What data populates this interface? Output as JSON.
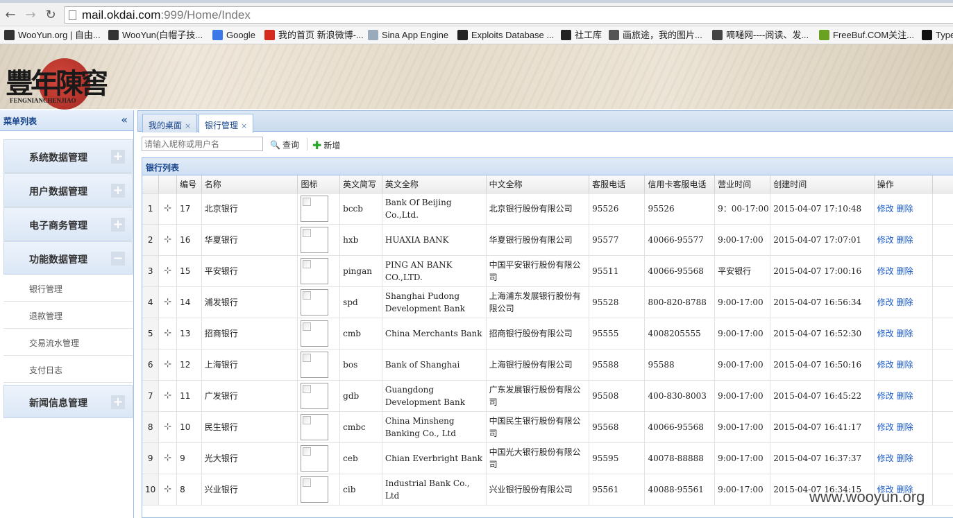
{
  "browser": {
    "url_host": "mail.okdai.com",
    "url_rest": ":999/Home/Index",
    "bookmarks": [
      {
        "label": "WooYun.org | 自由...",
        "icon": "wooyun-icon",
        "color": "#333"
      },
      {
        "label": "WooYun(白帽子技...",
        "icon": "wooyun-icon",
        "color": "#333"
      },
      {
        "label": "Google",
        "icon": "google-icon",
        "color": "#3b78e7"
      },
      {
        "label": "我的首页 新浪微博-...",
        "icon": "weibo-icon",
        "color": "#d52b1e"
      },
      {
        "label": "Sina App Engine",
        "icon": "cloud-icon",
        "color": "#9ab"
      },
      {
        "label": "Exploits Database ...",
        "icon": "exploit-db-icon",
        "color": "#222"
      },
      {
        "label": "社工库",
        "icon": "folder-icon",
        "color": "#222"
      },
      {
        "label": "画旅途，我的图片...",
        "icon": "image-icon",
        "color": "#555"
      },
      {
        "label": "嘀嗵网----阅读、发...",
        "icon": "bird-icon",
        "color": "#444"
      },
      {
        "label": "FreeBuf.COM关注...",
        "icon": "freebuf-icon",
        "color": "#6aa121"
      },
      {
        "label": "Type",
        "icon": "typecho-icon",
        "color": "#111"
      }
    ]
  },
  "banner": {
    "logo_text": "豐年陳窖",
    "logo_sub": "FENGNIANCHENJIAO"
  },
  "sidebar": {
    "title": "菜单列表",
    "collapse_icon": "«",
    "sections": [
      {
        "label": "系统数据管理",
        "toggle": "+"
      },
      {
        "label": "用户数据管理",
        "toggle": "+"
      },
      {
        "label": "电子商务管理",
        "toggle": "+"
      },
      {
        "label": "功能数据管理",
        "toggle": "−"
      }
    ],
    "sub_items": [
      "银行管理",
      "退款管理",
      "交易流水管理",
      "支付日志"
    ],
    "last_section": {
      "label": "新闻信息管理",
      "toggle": "+"
    }
  },
  "tabs": [
    {
      "label": "我的桌面",
      "close": "×"
    },
    {
      "label": "银行管理",
      "close": "×"
    }
  ],
  "toolbar": {
    "search_placeholder": "请输入昵称或用户名",
    "query_label": "查询",
    "add_label": "新增"
  },
  "grid": {
    "title": "银行列表",
    "columns": [
      "",
      "",
      "编号",
      "名称",
      "图标",
      "英文简写",
      "英文全称",
      "中文全称",
      "客服电话",
      "信用卡客服电话",
      "营业时间",
      "创建时间",
      "操作"
    ],
    "edit_label": "修改",
    "delete_label": "删除",
    "rows": [
      {
        "n": "1",
        "id": "17",
        "name": "北京银行",
        "abbr": "bccb",
        "en": "Bank Of Beijing Co.,Ltd.",
        "cn": "北京银行股份有限公司",
        "tel": "95526",
        "cc": "95526",
        "hours": "9：00-17:00",
        "created": "2015-04-07 17:10:48"
      },
      {
        "n": "2",
        "id": "16",
        "name": "华夏银行",
        "abbr": "hxb",
        "en": "HUAXIA BANK",
        "cn": "华夏银行股份有限公司",
        "tel": "95577",
        "cc": "40066-95577",
        "hours": "9:00-17:00",
        "created": "2015-04-07 17:07:01"
      },
      {
        "n": "3",
        "id": "15",
        "name": "平安银行",
        "abbr": "pingan",
        "en": "PING AN BANK CO.,LTD.",
        "cn": "中国平安银行股份有限公司",
        "tel": "95511",
        "cc": "40066-95568",
        "hours": "平安银行",
        "created": "2015-04-07 17:00:16"
      },
      {
        "n": "4",
        "id": "14",
        "name": "浦发银行",
        "abbr": "spd",
        "en": "Shanghai Pudong Development Bank",
        "cn": "上海浦东发展银行股份有限公司",
        "tel": "95528",
        "cc": "800-820-8788",
        "hours": "9:00-17:00",
        "created": "2015-04-07 16:56:34"
      },
      {
        "n": "5",
        "id": "13",
        "name": "招商银行",
        "abbr": "cmb",
        "en": "China Merchants Bank",
        "cn": "招商银行股份有限公司",
        "tel": "95555",
        "cc": "4008205555",
        "hours": "9:00-17:00",
        "created": "2015-04-07 16:52:30"
      },
      {
        "n": "6",
        "id": "12",
        "name": "上海银行",
        "abbr": "bos",
        "en": "Bank of Shanghai",
        "cn": "上海银行股份有限公司",
        "tel": "95588",
        "cc": "95588",
        "hours": "9:00-17:00",
        "created": "2015-04-07 16:50:16"
      },
      {
        "n": "7",
        "id": "11",
        "name": "广发银行",
        "abbr": "gdb",
        "en": "Guangdong Development Bank",
        "cn": "广东发展银行股份有限公司",
        "tel": "95508",
        "cc": "400-830-8003",
        "hours": "9:00-17:00",
        "created": "2015-04-07 16:45:22"
      },
      {
        "n": "8",
        "id": "10",
        "name": "民生银行",
        "abbr": "cmbc",
        "en": "China Minsheng Banking Co., Ltd",
        "cn": "中国民生银行股份有限公司",
        "tel": "95568",
        "cc": "40066-95568",
        "hours": "9:00-17:00",
        "created": "2015-04-07 16:41:17"
      },
      {
        "n": "9",
        "id": "9",
        "name": "光大银行",
        "abbr": "ceb",
        "en": "Chian Everbright Bank",
        "cn": "中国光大银行股份有限公司",
        "tel": "95595",
        "cc": "40078-88888",
        "hours": "9:00-17:00",
        "created": "2015-04-07 16:37:37"
      },
      {
        "n": "10",
        "id": "8",
        "name": "兴业银行",
        "abbr": "cib",
        "en": "Industrial Bank Co., Ltd",
        "cn": "兴业银行股份有限公司",
        "tel": "95561",
        "cc": "40088-95561",
        "hours": "9:00-17:00",
        "created": "2015-04-07 16:34:15"
      }
    ]
  },
  "watermark": "www.wooyun.org"
}
